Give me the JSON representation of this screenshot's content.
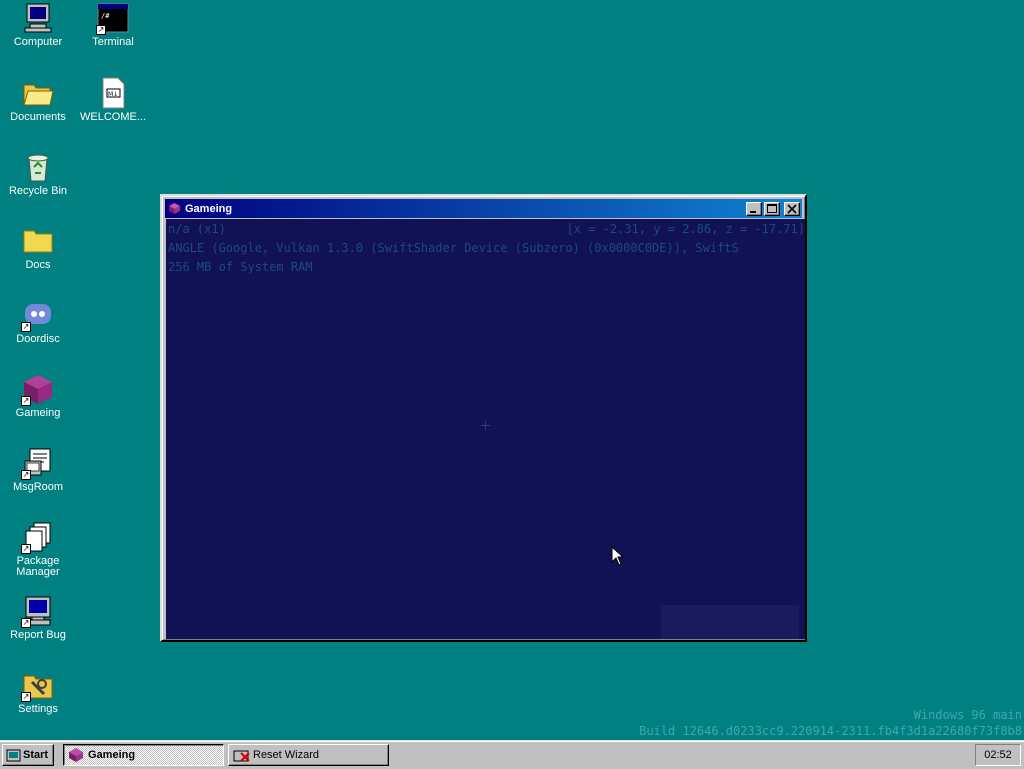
{
  "desktop": {
    "icons": [
      {
        "label": "Computer",
        "icon": "computer-icon"
      },
      {
        "label": "Terminal",
        "icon": "terminal-icon"
      },
      {
        "label": "Documents",
        "icon": "open-folder-icon"
      },
      {
        "label": "WELCOME...",
        "icon": "markdown-file-icon"
      },
      {
        "label": "Recycle Bin",
        "icon": "recycle-bin-icon"
      },
      {
        "label": "Docs",
        "icon": "folder-icon"
      },
      {
        "label": "Doordisc",
        "icon": "chat-app-icon"
      },
      {
        "label": "Gameing",
        "icon": "game-cube-icon"
      },
      {
        "label": "MsgRoom",
        "icon": "msgroom-icon"
      },
      {
        "label": "Package Manager",
        "icon": "package-manager-icon"
      },
      {
        "label": "Report Bug",
        "icon": "report-bug-icon"
      },
      {
        "label": "Settings",
        "icon": "settings-folder-icon"
      }
    ]
  },
  "window": {
    "title": "Gameing",
    "hud": {
      "fps": "n/a (x1)",
      "coords": "[x = -2.31, y = 2.86, z = -17.71]",
      "renderer": "ANGLE (Google, Vulkan 1.3.0 (SwiftShader Device (Subzero) (0x0000C0DE)), SwiftS",
      "ram": "256 MB of System RAM"
    }
  },
  "watermark": {
    "line1": "Windows 96 main",
    "line2": "Build 12646.d0233cc9.220914-2311.fb4f3d1a22680f73f8b8"
  },
  "taskbar": {
    "start_label": "Start",
    "tasks": [
      {
        "label": "Gameing",
        "active": true
      },
      {
        "label": "Reset Wizard",
        "active": false
      }
    ],
    "clock": "02:52"
  },
  "colors": {
    "desktop": "#008080",
    "titlebar_start": "#000080",
    "titlebar_end": "#1084d0",
    "viewport": "#111155"
  }
}
